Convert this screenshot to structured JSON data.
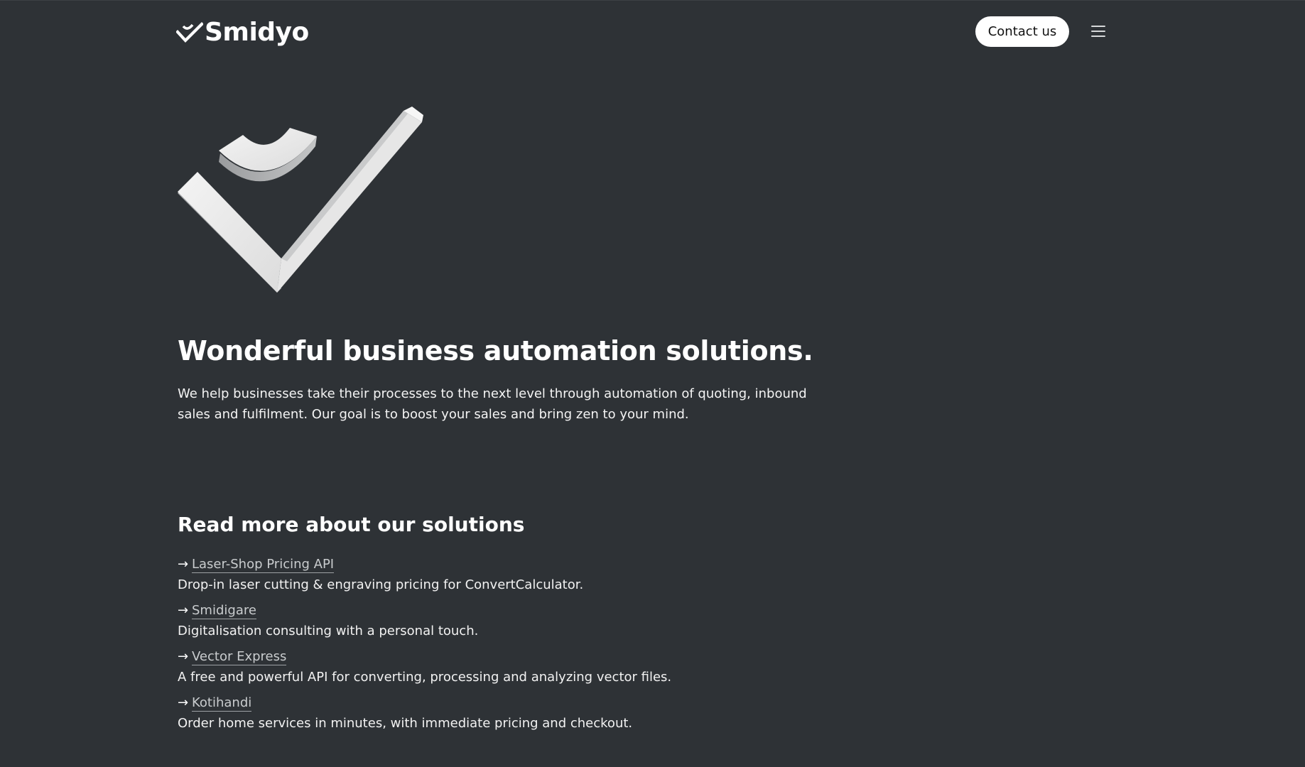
{
  "header": {
    "brand": "Smidyo",
    "contact_label": "Contact us"
  },
  "hero": {
    "headline": "Wonderful business automation solutions.",
    "intro": "We help businesses take their processes to the next level through automation of quoting, inbound sales and fulfilment. Our goal is to boost your sales and bring zen to your mind."
  },
  "solutions": {
    "heading": "Read more about our solutions",
    "arrow": "→",
    "items": [
      {
        "title": "Laser-Shop Pricing API",
        "description": "Drop-in laser cutting & engraving pricing for ConvertCalculator."
      },
      {
        "title": "Smidigare",
        "description": "Digitalisation consulting with a personal touch."
      },
      {
        "title": "Vector Express",
        "description": "A free and powerful API for converting, processing and analyzing vector files."
      },
      {
        "title": "Kotihandi",
        "description": "Order home services in minutes, with immediate pricing and checkout."
      }
    ]
  },
  "icons": {
    "logo": "checkmark-smile-logo-icon",
    "hero": "checkmark-smile-3d-icon",
    "menu": "hamburger-menu-icon"
  },
  "colors": {
    "background": "#2e3236",
    "text": "#ffffff",
    "link": "#c9ccce",
    "button_bg": "#ffffff",
    "button_text": "#111111"
  }
}
